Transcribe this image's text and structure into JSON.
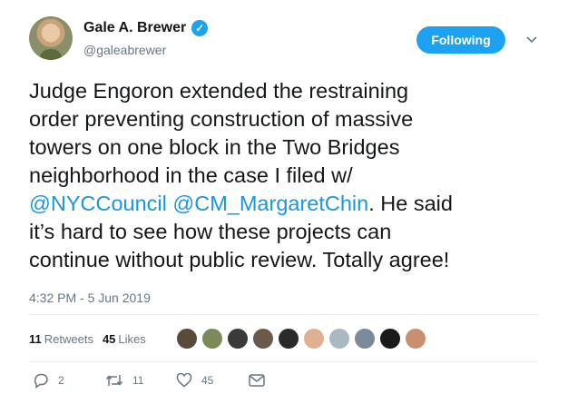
{
  "author": {
    "name": "Gale A. Brewer",
    "handle": "@galeabrewer"
  },
  "follow_button": "Following",
  "tweet": {
    "lines": [
      [
        {
          "t": "Judge Engoron extended the restraining"
        }
      ],
      [
        {
          "t": "order preventing construction of massive"
        }
      ],
      [
        {
          "t": "towers on one block in the Two Bridges"
        }
      ],
      [
        {
          "t": "neighborhood in the case I filed w/"
        }
      ],
      [
        {
          "t": "@NYCCouncil",
          "m": true
        },
        {
          "t": " "
        },
        {
          "t": "@CM_MargaretChin",
          "m": true
        },
        {
          "t": ". He said"
        }
      ],
      [
        {
          "t": "it’s hard to see how these projects can"
        }
      ],
      [
        {
          "t": "continue without public review. Totally agree!"
        }
      ]
    ]
  },
  "timestamp": "4:32 PM - 5 Jun 2019",
  "stats": {
    "retweets_count": "11",
    "retweets_label": "Retweets",
    "likes_count": "45",
    "likes_label": "Likes"
  },
  "likers": [
    "#5a4a3a",
    "#7c8a5a",
    "#3a3a3a",
    "#6b5a4a",
    "#2a2a2a",
    "#e0b090",
    "#aab8c2",
    "#7a8a9a",
    "#1a1a1a",
    "#c89070"
  ],
  "actions": {
    "reply_count": "2",
    "retweet_count": "11",
    "like_count": "45"
  },
  "colors": {
    "accent": "#1da1f2",
    "mention": "#1b95e0",
    "muted": "#657786"
  }
}
